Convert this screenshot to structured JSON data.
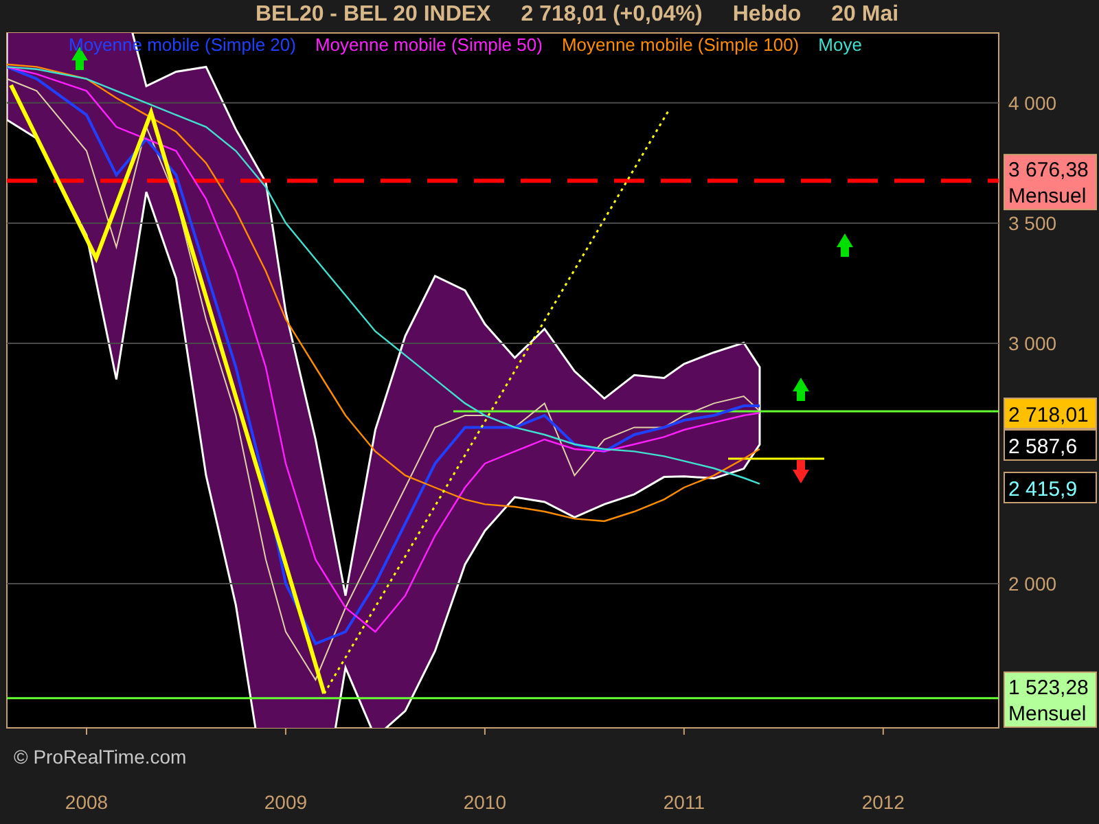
{
  "title": {
    "symbol": "BEL20 - BEL 20 INDEX",
    "quote": "2 718,01 (+0,04%)",
    "period": "Hebdo",
    "date": "20 Mai"
  },
  "chart": {
    "credit": "© ProRealTime.com",
    "chart_data": {
      "type": "line",
      "x": [
        2007.6,
        2007.75,
        2008,
        2008.15,
        2008.3,
        2008.45,
        2008.6,
        2008.75,
        2008.9,
        2009,
        2009.15,
        2009.3,
        2009.45,
        2009.6,
        2009.75,
        2009.9,
        2010,
        2010.15,
        2010.3,
        2010.45,
        2010.6,
        2010.75,
        2010.9,
        2011,
        2011.15,
        2011.3,
        2011.38
      ],
      "series": [
        {
          "color": "#e0d0a8",
          "values": [
            4100,
            4050,
            3800,
            3400,
            3900,
            3600,
            3100,
            2700,
            2100,
            1800,
            1600,
            1900,
            2150,
            2400,
            2650,
            2700,
            2700,
            2650,
            2750,
            2450,
            2600,
            2650,
            2650,
            2700,
            2750,
            2780,
            2718
          ]
        },
        {
          "name": "Moyenne mobile (Simple 20)",
          "color": "#2040ff",
          "values": [
            4150,
            4100,
            3950,
            3700,
            3850,
            3700,
            3300,
            2900,
            2400,
            2000,
            1750,
            1800,
            2000,
            2250,
            2500,
            2650,
            2650,
            2650,
            2700,
            2580,
            2550,
            2620,
            2650,
            2680,
            2700,
            2740,
            2740
          ]
        },
        {
          "name": "Moyenne mobile (Simple 50)",
          "color": "#ff20ff",
          "values": [
            4150,
            4120,
            4050,
            3900,
            3850,
            3800,
            3600,
            3300,
            2900,
            2500,
            2100,
            1900,
            1800,
            1950,
            2200,
            2400,
            2500,
            2550,
            2600,
            2560,
            2550,
            2580,
            2610,
            2640,
            2670,
            2700,
            2710
          ]
        },
        {
          "name": "Moyenne mobile (Simple 100)",
          "color": "#ff8c00",
          "values": [
            4160,
            4150,
            4100,
            4020,
            3950,
            3880,
            3750,
            3550,
            3300,
            3100,
            2900,
            2700,
            2550,
            2450,
            2400,
            2350,
            2330,
            2320,
            2300,
            2270,
            2260,
            2300,
            2350,
            2400,
            2450,
            2520,
            2560
          ]
        },
        {
          "name": "Moye",
          "color": "#40e0d0",
          "values": [
            4150,
            4140,
            4100,
            4050,
            4000,
            3950,
            3900,
            3800,
            3650,
            3500,
            3350,
            3200,
            3050,
            2950,
            2850,
            2750,
            2700,
            2650,
            2620,
            2580,
            2560,
            2550,
            2530,
            2510,
            2480,
            2440,
            2415
          ]
        }
      ],
      "xlim": [
        2007.6,
        2012.58
      ],
      "ylim": [
        1400,
        4291
      ],
      "grid": true,
      "xticks": [
        {
          "value": 2008,
          "label": "2008"
        },
        {
          "value": 2009,
          "label": "2009"
        },
        {
          "value": 2010,
          "label": "2010"
        },
        {
          "value": 2011,
          "label": "2011"
        },
        {
          "value": 2012,
          "label": "2012"
        }
      ],
      "yticks": [
        {
          "value": 2000,
          "label": "2 000"
        },
        {
          "value": 3000,
          "label": "3 000"
        },
        {
          "value": 3500,
          "label": "3 500"
        },
        {
          "value": 4000,
          "label": "4 000"
        }
      ],
      "ref_lines": [
        {
          "axis": "y",
          "value": 3676.38,
          "color": "#ff0000",
          "label": "3 676,38"
        },
        {
          "axis": "y",
          "value": 2716.7,
          "color": "#66ff33"
        },
        {
          "axis": "y",
          "value": 2520,
          "color": "#ffff00"
        },
        {
          "axis": "y",
          "value": 1523.28,
          "color": "#66ff33",
          "label": "1 523,28"
        }
      ]
    },
    "tag_notes": [
      "Mensuel",
      "Mensuel"
    ],
    "price_tags": [
      {
        "kind": "filled",
        "text": "2 718,01",
        "color": "#ffc000"
      },
      {
        "kind": "outline",
        "text": "2 587,6",
        "color": "#ffffff"
      },
      {
        "kind": "outline",
        "text": "2 415,9",
        "color": "#80ffff"
      }
    ]
  }
}
